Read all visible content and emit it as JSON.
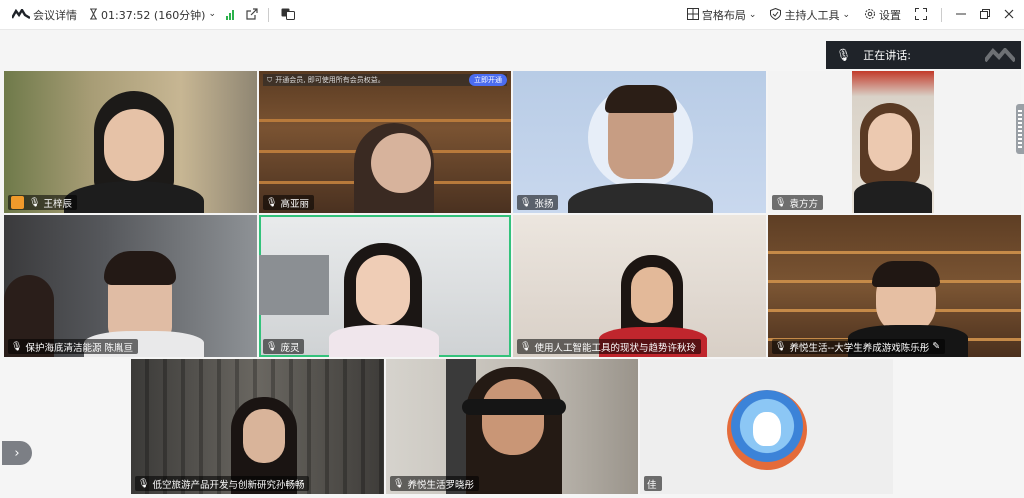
{
  "topbar": {
    "meeting_details": "会议详情",
    "timer": "01:37:52 (160分钟)",
    "grid_layout": "宫格布局",
    "host_tools": "主持人工具",
    "settings": "设置"
  },
  "speaker_bar": {
    "label": "正在讲话:"
  },
  "banner": {
    "text": "开通会员, 即可使用所有会员权益。",
    "button": "立即开通"
  },
  "participants": [
    {
      "name": "王梓辰",
      "host": true
    },
    {
      "name": "高亚丽"
    },
    {
      "name": "张扬"
    },
    {
      "name": "袁方方"
    },
    {
      "name": "保护海底清洁能源 陈胤亘"
    },
    {
      "name": "庞灵"
    },
    {
      "name": "使用人工智能工具的现状与趋势许秋玲"
    },
    {
      "name": "养悦生活--大学生养成游戏陈乐彤"
    },
    {
      "name": "低空旅游产品开发与创新研究孙畅畅"
    },
    {
      "name": "养悦生活罗晓彤"
    },
    {
      "name": "佳"
    }
  ],
  "icons": {
    "app_logo": "app-logo-icon",
    "timer": "hourglass-icon",
    "signal": "signal-icon",
    "share": "share-icon",
    "translate": "translate-icon",
    "grid": "grid-icon",
    "shield": "shield-icon",
    "gear": "gear-icon",
    "fullscreen": "fullscreen-icon",
    "minimize": "minimize-icon",
    "restore": "restore-icon",
    "close": "close-icon",
    "mic": "mic-icon",
    "pen": "pen-icon",
    "next": "chevron-right-icon"
  },
  "colors": {
    "active_border": "#33c27b",
    "signal": "#2bb24c",
    "host_badge": "#f09a2b",
    "vip": "#4b6cf0"
  },
  "next_button": "›"
}
